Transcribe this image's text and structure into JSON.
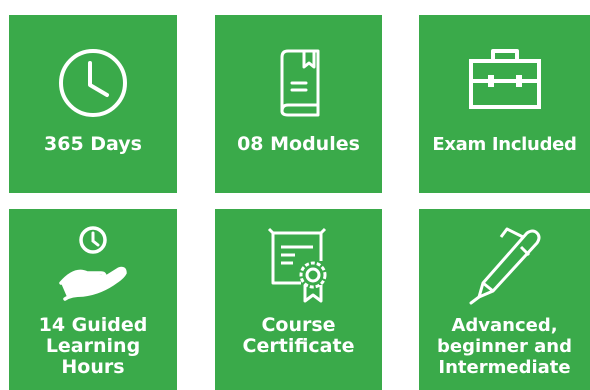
{
  "tiles": [
    {
      "icon": "clock-icon",
      "lines": [
        "365 Days"
      ]
    },
    {
      "icon": "book-icon",
      "lines": [
        "08 Modules"
      ]
    },
    {
      "icon": "briefcase-icon",
      "lines": [
        "Exam Included"
      ]
    },
    {
      "icon": "hand-clock-icon",
      "lines": [
        "14 Guided",
        "Learning",
        "Hours"
      ]
    },
    {
      "icon": "certificate-icon",
      "lines": [
        "Course",
        "Certificate"
      ]
    },
    {
      "icon": "pen-icon",
      "lines": [
        "Advanced,",
        "beginner and",
        "Intermediate"
      ]
    }
  ],
  "colors": {
    "tile": "#3aaa4a",
    "icon": "#ffffff",
    "text": "#ffffff"
  }
}
